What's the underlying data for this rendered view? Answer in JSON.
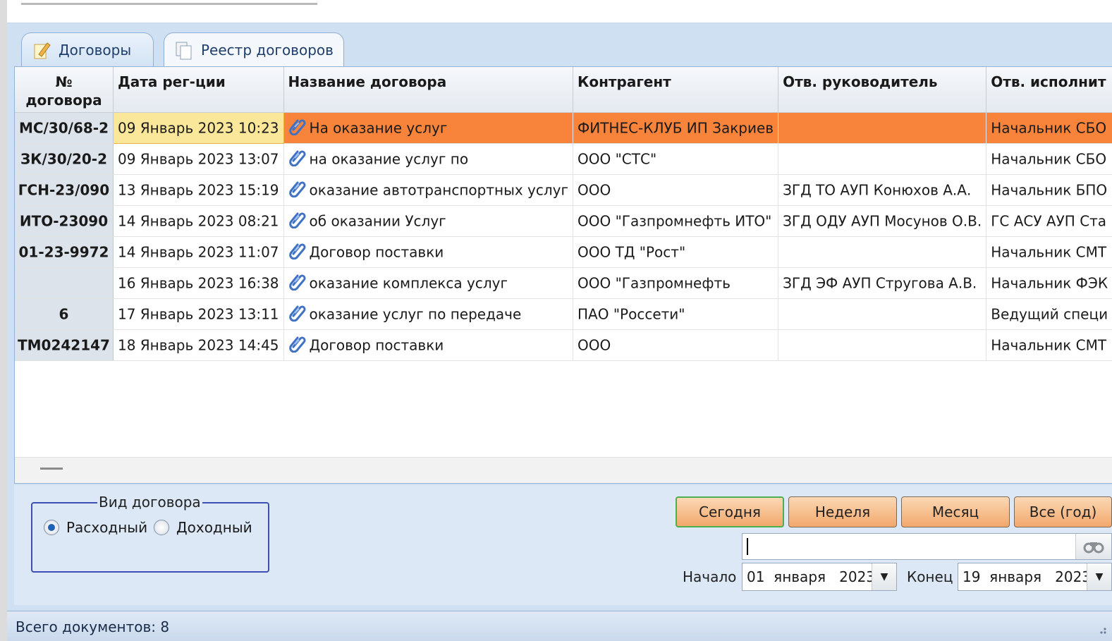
{
  "tabs": [
    {
      "label": "Договоры",
      "icon": "pencil-document-icon",
      "active": false
    },
    {
      "label": "Реестр договоров",
      "icon": "documents-icon",
      "active": true
    }
  ],
  "table": {
    "columns": [
      "№\nдоговора",
      "Дата рег-ции",
      "Название договора",
      "Контрагент",
      "Отв. руководитель",
      "Отв. исполнит"
    ],
    "rows": [
      {
        "num": "МС/30/68-2",
        "date": "09 Январь 2023 10:23",
        "name": "На оказание услуг",
        "contractor": "ФИТНЕС-КЛУБ ИП Закриев",
        "head": "",
        "executor": "Начальник СБО",
        "selected": true
      },
      {
        "num": "ЗК/30/20-2",
        "date": "09 Январь 2023 13:07",
        "name": "на оказание услуг по",
        "contractor": "ООО \"СТС\"",
        "head": "",
        "executor": "Начальник СБО"
      },
      {
        "num": "ГСН-23/090",
        "date": "13 Январь 2023 15:19",
        "name": "оказание автотранспортных услуг",
        "contractor": "ООО",
        "head": "ЗГД ТО АУП Конюхов А.А.",
        "executor": "Начальник БПО"
      },
      {
        "num": "ИТО-23090",
        "date": "14 Январь 2023 08:21",
        "name": "об оказании Услуг",
        "contractor": "ООО \"Газпромнефть ИТО\"",
        "head": "ЗГД ОДУ АУП Мосунов О.В.",
        "executor": "ГС АСУ АУП Ста"
      },
      {
        "num": "01-23-9972",
        "date": "14 Январь 2023 11:07",
        "name": "Договор поставки",
        "contractor": "ООО ТД \"Рост\"",
        "head": "",
        "executor": "Начальник СМТ"
      },
      {
        "num": "",
        "date": "16 Январь 2023 16:38",
        "name": "оказание комплекса услуг",
        "contractor": "ООО \"Газпромнефть",
        "head": "ЗГД ЭФ АУП Стругова А.В.",
        "executor": "Начальник ФЭК"
      },
      {
        "num": "6",
        "date": "17 Январь 2023 13:11",
        "name": "оказание услуг по передаче",
        "contractor": "ПАО \"Россети\"",
        "head": "",
        "executor": "Ведущий специ"
      },
      {
        "num": "ТМ0242147",
        "date": "18 Январь 2023 14:45",
        "name": "Договор поставки",
        "contractor": "ООО",
        "head": "",
        "executor": "Начальник СМТ"
      }
    ]
  },
  "contract_type": {
    "legend": "Вид договора",
    "options": [
      {
        "label": "Расходный",
        "checked": true
      },
      {
        "label": "Доходный",
        "checked": false
      }
    ]
  },
  "period_buttons": [
    "Сегодня",
    "Неделя",
    "Месяц",
    "Все (год)"
  ],
  "search": {
    "value": ""
  },
  "range": {
    "start_label": "Начало",
    "start_value": "01  января   2023",
    "end_label": "Конец",
    "end_value": "19  января   2023"
  },
  "status": {
    "text": "Всего документов: 8"
  },
  "colors": {
    "selected_row": "#f7843a",
    "selected_date": "#fbe79a",
    "button": "#f2a86b",
    "tab_text": "#1e3f6e"
  }
}
